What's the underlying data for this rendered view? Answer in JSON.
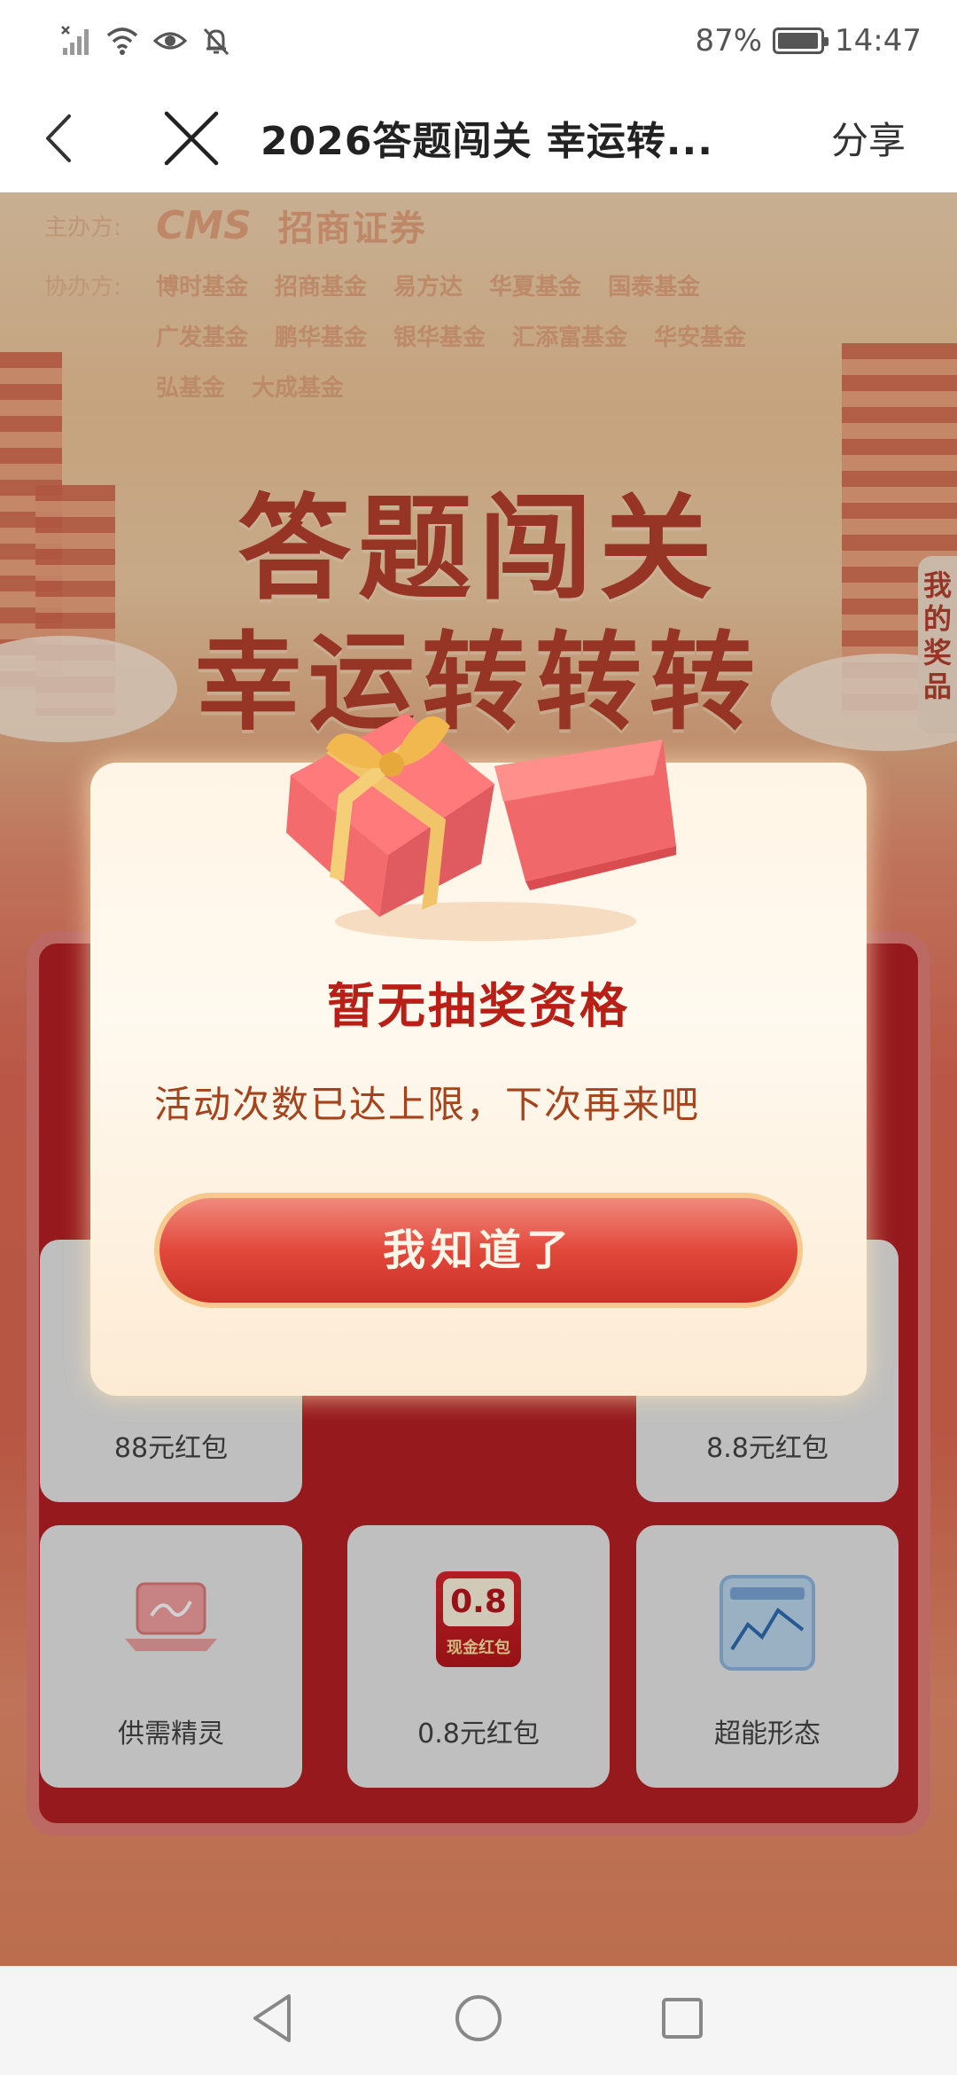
{
  "status_bar": {
    "battery_percent": "87%",
    "time": "14:47",
    "icons": [
      "signal-off-icon",
      "wifi-icon",
      "eye-icon",
      "bell-muted-icon",
      "battery-icon"
    ],
    "battery_level": 0.87
  },
  "nav": {
    "title": "2026答题闯关 幸运转...",
    "share_label": "分享"
  },
  "sponsors": {
    "host_label": "主办方:",
    "host_brand": "CMS",
    "host_name": "招商证券",
    "co_label": "协办方:",
    "logos_row1": [
      "博时基金",
      "招商基金",
      "易方达",
      "华夏基金",
      "国泰基金"
    ],
    "logos_row2": [
      "广发基金",
      "鹏华基金",
      "银华基金",
      "汇添富基金",
      "华安基金"
    ],
    "logos_row3": [
      "弘基金",
      "大成基金"
    ]
  },
  "hero": {
    "line1": "答题闯关",
    "line2": "幸运转转转"
  },
  "prize_tab": "我的奖品",
  "grid": {
    "cells": [
      {
        "label": "88元红包"
      },
      {
        "label": "8.8元红包"
      },
      {
        "label": "供需精灵"
      },
      {
        "label": "0.8元红包",
        "coupon_value": "0.8",
        "coupon_text": "现金红包"
      },
      {
        "label": "超能形态"
      }
    ]
  },
  "modal": {
    "title": "暂无抽奖资格",
    "message": "活动次数已达上限，下次再来吧",
    "button": "我知道了"
  },
  "colors": {
    "accent_red": "#b81f16",
    "message_brown": "#a5431d",
    "panel_red": "#b81f24"
  }
}
